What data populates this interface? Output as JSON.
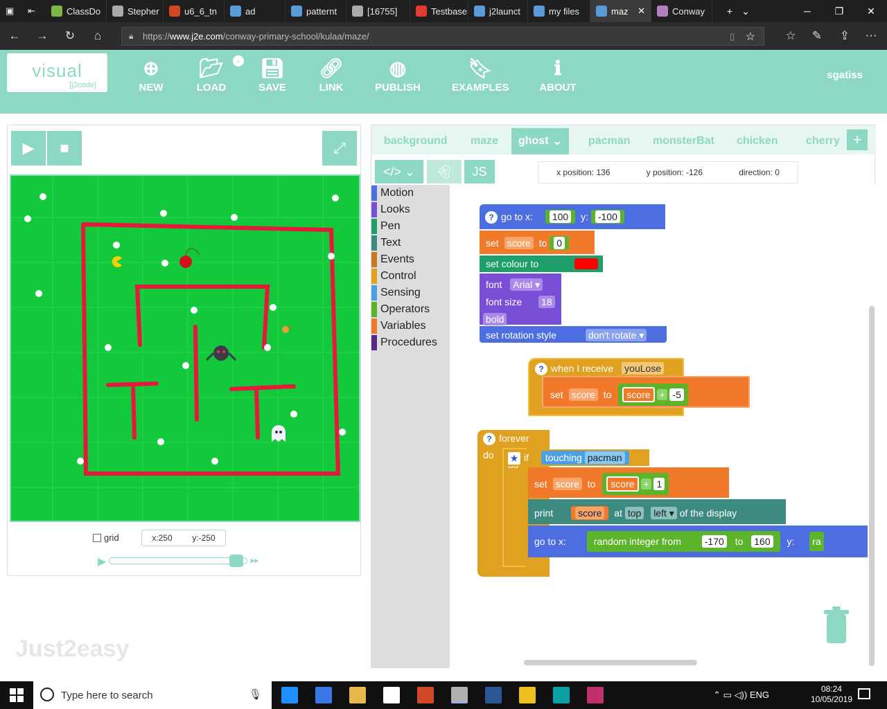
{
  "browser": {
    "tabs": [
      {
        "label": "ClassDo",
        "color": "#7ab648"
      },
      {
        "label": "Stepher",
        "color": "#aaaaaa"
      },
      {
        "label": "u6_6_tn",
        "color": "#d24726"
      },
      {
        "label": "ad",
        "color": "#5b9bd5"
      },
      {
        "label": "patternt",
        "color": "#5b9bd5"
      },
      {
        "label": "[16755]",
        "color": "#aaaaaa"
      },
      {
        "label": "Testbase",
        "color": "#e03c31"
      },
      {
        "label": "j2launct",
        "color": "#5b9bd5"
      },
      {
        "label": "my files",
        "color": "#5b9bd5"
      },
      {
        "label": "maz",
        "color": "#5b9bd5"
      },
      {
        "label": "Conway",
        "color": "#b080c0"
      }
    ],
    "url_prefix": "https://",
    "url_domain": "www.j2e.com",
    "url_path": "/conway-primary-school/kulaa/maze/"
  },
  "app": {
    "logo_main": "visual",
    "logo_sub": "[j2code]",
    "menu": [
      "NEW",
      "LOAD",
      "SAVE",
      "LINK",
      "PUBLISH",
      "EXAMPLES",
      "ABOUT"
    ],
    "user": "sgatiss",
    "watermark": "Just2easy"
  },
  "stage": {
    "grid_label": "grid",
    "x_readout": "x:250",
    "y_readout": "y:-250",
    "slider_fraction": 0.92
  },
  "editor": {
    "sprite_tabs": [
      "background",
      "maze",
      "ghost",
      "pacman",
      "monsterBat",
      "chicken",
      "cherry"
    ],
    "active_tab": "ghost",
    "mode_js": "JS",
    "x_position": "x position: 136",
    "y_position": "y position: -126",
    "direction": "direction: 0",
    "categories": [
      {
        "name": "Motion",
        "color": "#4c6ee0"
      },
      {
        "name": "Looks",
        "color": "#7a4fd8"
      },
      {
        "name": "Pen",
        "color": "#1e9e6a"
      },
      {
        "name": "Text",
        "color": "#3d8b80"
      },
      {
        "name": "Events",
        "color": "#c8791e"
      },
      {
        "name": "Control",
        "color": "#e0a020"
      },
      {
        "name": "Sensing",
        "color": "#4aa0e0"
      },
      {
        "name": "Operators",
        "color": "#5cb42a"
      },
      {
        "name": "Variables",
        "color": "#f07a2a"
      },
      {
        "name": "Procedures",
        "color": "#5a2a8a"
      }
    ]
  },
  "blocks": {
    "goto_label": "go to x:",
    "goto_x": "100",
    "y_label": "y:",
    "goto_y": "-100",
    "set_label": "set",
    "score_var": "score",
    "to_label": "to",
    "score_init": "0",
    "set_colour": "set colour to",
    "colour": "#ff0000",
    "font_label": "font",
    "font_value": "Arial",
    "font_size_label": "font size",
    "font_size_value": "18",
    "bold_label": "bold",
    "rotation_label": "set rotation style",
    "rotation_value": "don't rotate",
    "when_receive": "when I receive",
    "message": "youLose",
    "plus": "+",
    "minus_five": "-5",
    "forever": "forever",
    "do": "do",
    "if": "if",
    "touching": "touching",
    "touch_target": "pacman",
    "one": "1",
    "print": "print",
    "at": "at",
    "pos_top": "top",
    "pos_left": "left",
    "of_display": "of the display",
    "random_label": "random integer from",
    "rand_min": "-170",
    "rand_to": "to",
    "rand_max": "160",
    "rand_trunc": "ra"
  },
  "taskbar": {
    "search_placeholder": "Type here to search",
    "lang": "ENG",
    "time": "08:24",
    "date": "10/05/2019",
    "apps": [
      "#1e90ff",
      "#3b78e7",
      "#e8b84a",
      "#ffffff",
      "#d24726",
      "#b0b0b0",
      "#2b5797",
      "#f0c020",
      "#0aa0a0",
      "#c0306a"
    ]
  }
}
